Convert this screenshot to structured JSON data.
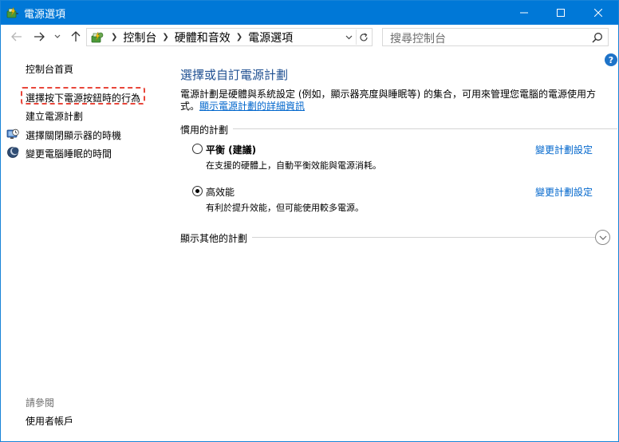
{
  "window": {
    "title": "電源選項"
  },
  "address_bar": {
    "breadcrumbs": [
      "控制台",
      "硬體和音效",
      "電源選項"
    ],
    "location_icon": "control-panel-icon"
  },
  "search": {
    "placeholder": "搜尋控制台"
  },
  "sidebar": {
    "home": "控制台首頁",
    "tasks": [
      {
        "label": "選擇按下電源按鈕時的行為",
        "icon": "",
        "highlighted": true
      },
      {
        "label": "建立電源計劃",
        "icon": ""
      },
      {
        "label": "選擇關閉顯示器的時機",
        "icon": "monitor-clock-icon"
      },
      {
        "label": "變更電腦睡眠的時間",
        "icon": "moon-icon"
      }
    ],
    "see_also": {
      "title": "請參閱",
      "items": [
        "使用者帳戶"
      ]
    }
  },
  "main": {
    "heading": "選擇或自訂電源計劃",
    "description": "電源計劃是硬體與系統設定 (例如，顯示器亮度與睡眠等) 的集合，可用來管理您電腦的電源使用方式。",
    "details_link": "顯示電源計劃的詳細資訊",
    "preferred_section": "慣用的計劃",
    "plans": [
      {
        "name": "平衡 (建議)",
        "description": "在支援的硬體上，自動平衡效能與電源消耗。",
        "selected": false,
        "change_link": "變更計劃設定"
      },
      {
        "name": "高效能",
        "description": "有利於提升效能，但可能使用較多電源。",
        "selected": true,
        "change_link": "變更計劃設定"
      }
    ],
    "more_section": "顯示其他的計劃"
  },
  "colors": {
    "titlebar": "#0078d7",
    "heading": "#1e4f91",
    "link": "#0066cc",
    "highlight_border": "#e8463a"
  }
}
